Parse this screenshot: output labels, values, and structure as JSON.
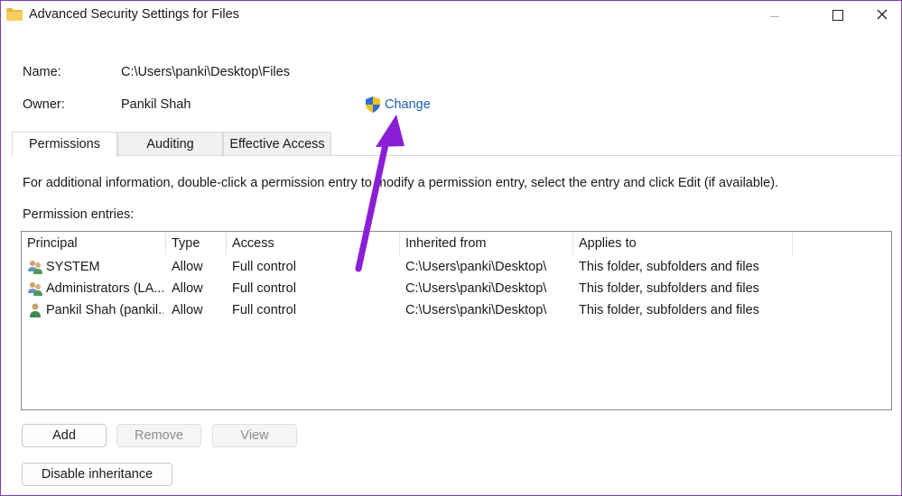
{
  "window": {
    "title": "Advanced Security Settings for Files"
  },
  "properties": {
    "name_label": "Name:",
    "name_value": "C:\\Users\\panki\\Desktop\\Files",
    "owner_label": "Owner:",
    "owner_value": "Pankil Shah",
    "change_link": "Change"
  },
  "tabs": [
    {
      "label": "Permissions",
      "active": true
    },
    {
      "label": "Auditing",
      "active": false
    },
    {
      "label": "Effective Access",
      "active": false
    }
  ],
  "info_text": "For additional information, double-click a permission entry to modify a permission entry, select the entry and click Edit (if available).",
  "permission_entries_label": "Permission entries:",
  "table": {
    "columns": [
      "Principal",
      "Type",
      "Access",
      "Inherited from",
      "Applies to"
    ],
    "rows": [
      {
        "principal": "SYSTEM",
        "type": "Allow",
        "access": "Full control",
        "inherited_from": "C:\\Users\\panki\\Desktop\\",
        "applies_to": "This folder, subfolders and files",
        "icon": "group-users-icon"
      },
      {
        "principal": "Administrators (LA...",
        "type": "Allow",
        "access": "Full control",
        "inherited_from": "C:\\Users\\panki\\Desktop\\",
        "applies_to": "This folder, subfolders and files",
        "icon": "group-users-icon"
      },
      {
        "principal": "Pankil Shah (pankil...",
        "type": "Allow",
        "access": "Full control",
        "inherited_from": "C:\\Users\\panki\\Desktop\\",
        "applies_to": "This folder, subfolders and files",
        "icon": "single-user-icon"
      }
    ]
  },
  "buttons": {
    "add": "Add",
    "remove": "Remove",
    "view": "View",
    "disable_inheritance": "Disable inheritance"
  },
  "colors": {
    "link": "#1a5fb4",
    "annotation_arrow": "#8a1fd6",
    "window_border": "#7a3fb8"
  }
}
